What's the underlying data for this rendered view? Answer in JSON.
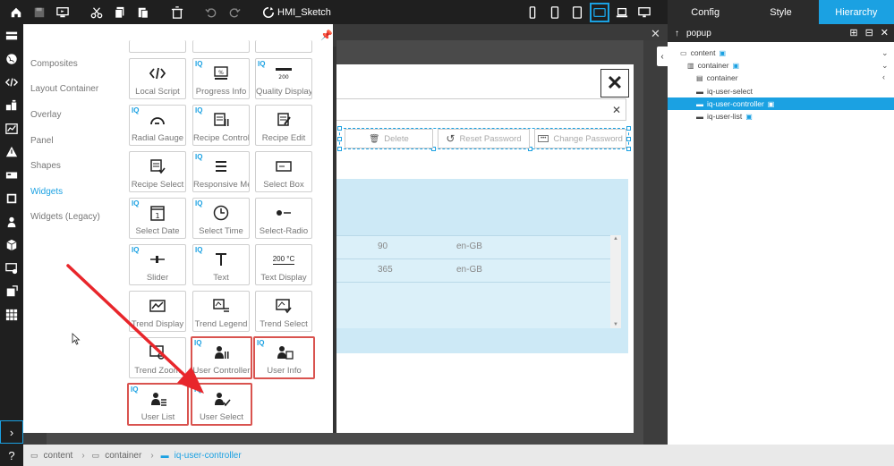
{
  "toolbar": {
    "sketch_name": "HMI_Sketch",
    "icons": [
      "home-icon",
      "save-icon",
      "preview-icon",
      "cut-icon",
      "copy-icon",
      "paste-icon",
      "delete-icon",
      "undo-icon",
      "redo-icon",
      "sketch-icon"
    ],
    "devices": [
      "phone-portrait-icon",
      "tablet-portrait-icon",
      "tablet-large-icon",
      "tablet-landscape-icon",
      "laptop-icon",
      "desktop-icon"
    ],
    "active_device": "tablet-landscape-icon"
  },
  "right_tabs": [
    {
      "label": "Config",
      "active": false
    },
    {
      "label": "Style",
      "active": false
    },
    {
      "label": "Hierarchy",
      "active": true
    }
  ],
  "categories": [
    {
      "label": "Composites",
      "active": false
    },
    {
      "label": "Layout Container",
      "active": false
    },
    {
      "label": "Overlay",
      "active": false
    },
    {
      "label": "Panel",
      "active": false
    },
    {
      "label": "Shapes",
      "active": false
    },
    {
      "label": "Widgets",
      "active": true
    },
    {
      "label": "Widgets (Legacy)",
      "active": false
    }
  ],
  "widgets": [
    {
      "label": "Local Script",
      "iq": false,
      "icon": "code-icon",
      "highlight": false
    },
    {
      "label": "Progress Info",
      "iq": true,
      "icon": "progress-icon",
      "highlight": false
    },
    {
      "label": "Quality Display",
      "iq": true,
      "icon": "quality-icon",
      "highlight": false
    },
    {
      "label": "Radial Gauge",
      "iq": true,
      "icon": "gauge-icon",
      "highlight": false
    },
    {
      "label": "Recipe Control",
      "iq": true,
      "icon": "recipe-control-icon",
      "highlight": false
    },
    {
      "label": "Recipe Edit",
      "iq": false,
      "icon": "recipe-edit-icon",
      "highlight": false
    },
    {
      "label": "Recipe Select",
      "iq": false,
      "icon": "recipe-select-icon",
      "highlight": false
    },
    {
      "label": "Responsive Menu",
      "iq": true,
      "icon": "menu-icon",
      "highlight": false
    },
    {
      "label": "Select Box",
      "iq": false,
      "icon": "select-box-icon",
      "highlight": false
    },
    {
      "label": "Select Date",
      "iq": true,
      "icon": "calendar-icon",
      "highlight": false
    },
    {
      "label": "Select Time",
      "iq": true,
      "icon": "clock-icon",
      "highlight": false
    },
    {
      "label": "Select-Radio",
      "iq": false,
      "icon": "radio-icon",
      "highlight": false
    },
    {
      "label": "Slider",
      "iq": true,
      "icon": "slider-icon",
      "highlight": false
    },
    {
      "label": "Text",
      "iq": true,
      "icon": "text-icon",
      "highlight": false
    },
    {
      "label": "Text Display",
      "iq": false,
      "icon": "text-display-icon",
      "highlight": false
    },
    {
      "label": "Trend Display",
      "iq": false,
      "icon": "trend-display-icon",
      "highlight": false
    },
    {
      "label": "Trend Legend",
      "iq": false,
      "icon": "trend-legend-icon",
      "highlight": false
    },
    {
      "label": "Trend Select",
      "iq": false,
      "icon": "trend-select-icon",
      "highlight": false
    },
    {
      "label": "Trend Zoom",
      "iq": false,
      "icon": "trend-zoom-icon",
      "highlight": false
    },
    {
      "label": "User Controller",
      "iq": true,
      "icon": "user-controller-icon",
      "highlight": true
    },
    {
      "label": "User Info",
      "iq": true,
      "icon": "user-info-icon",
      "highlight": true
    },
    {
      "label": "User List",
      "iq": true,
      "icon": "user-list-icon",
      "highlight": true
    },
    {
      "label": "User Select",
      "iq": true,
      "icon": "user-select-icon",
      "highlight": true
    }
  ],
  "text_display_value": "200 °C",
  "popup": {
    "buttons": [
      {
        "label": "Delete",
        "icon": "trash-icon"
      },
      {
        "label": "Reset Password",
        "icon": "reset-icon"
      },
      {
        "label": "Change Password",
        "icon": "password-icon"
      }
    ],
    "rows": [
      {
        "value": "90",
        "locale": "en-GB"
      },
      {
        "value": "365",
        "locale": "en-GB"
      }
    ]
  },
  "hierarchy": {
    "title": "popup",
    "nodes": [
      {
        "label": "content",
        "icon": "content-icon",
        "selected": false
      },
      {
        "label": "container",
        "icon": "container-icon",
        "selected": false
      },
      {
        "label": "container",
        "icon": "container-icon",
        "selected": false
      },
      {
        "label": "iq-user-select",
        "icon": "widget-icon",
        "selected": false
      },
      {
        "label": "iq-user-controller",
        "icon": "widget-icon",
        "selected": true
      },
      {
        "label": "iq-user-list",
        "icon": "widget-icon",
        "selected": false
      }
    ]
  },
  "breadcrumb": [
    {
      "label": "content",
      "active": false
    },
    {
      "label": "container",
      "active": false
    },
    {
      "label": "iq-user-controller",
      "active": true
    }
  ],
  "colors": {
    "accent": "#1ba1e2",
    "highlight": "#d9534f",
    "arrow": "#e8262b"
  }
}
